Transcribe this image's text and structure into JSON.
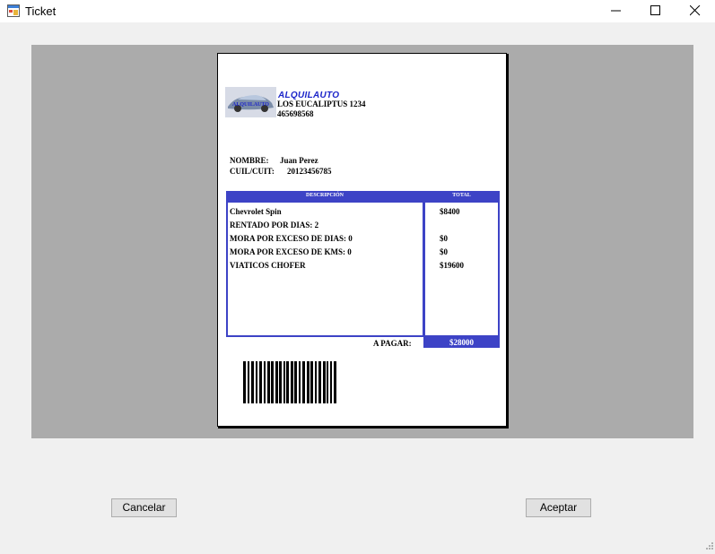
{
  "window": {
    "title": "Ticket",
    "icon": "form-icon"
  },
  "ticket": {
    "company": {
      "logo_text": "ALQUILAUTO",
      "name": "ALQUILAUTO",
      "address": "LOS EUCALIPTUS 1234",
      "phone": "465698568"
    },
    "client": {
      "name_label": "NOMBRE:",
      "name_value": "Juan Perez",
      "cuit_label": "CUIL/CUIT:",
      "cuit_value": "20123456785"
    },
    "table": {
      "header_description": "DESCRIPCIÓN",
      "header_total": "TOTAL",
      "rows": [
        {
          "description": "Chevrolet Spin",
          "total": "$8400"
        },
        {
          "description": "RENTADO POR DIAS: 2",
          "total": ""
        },
        {
          "description": "MORA POR EXCESO DE DIAS: 0",
          "total": "$0"
        },
        {
          "description": "MORA POR EXCESO DE KMS: 0",
          "total": "$0"
        },
        {
          "description": "VIATICOS CHOFER",
          "total": "$19600"
        }
      ]
    },
    "payment": {
      "label": "A PAGAR:",
      "value": "$28000"
    }
  },
  "buttons": {
    "cancel": "Cancelar",
    "accept": "Aceptar"
  },
  "colors": {
    "accent": "#3d43c6",
    "preview_bg": "#ababab",
    "brand": "#1c25c9"
  }
}
